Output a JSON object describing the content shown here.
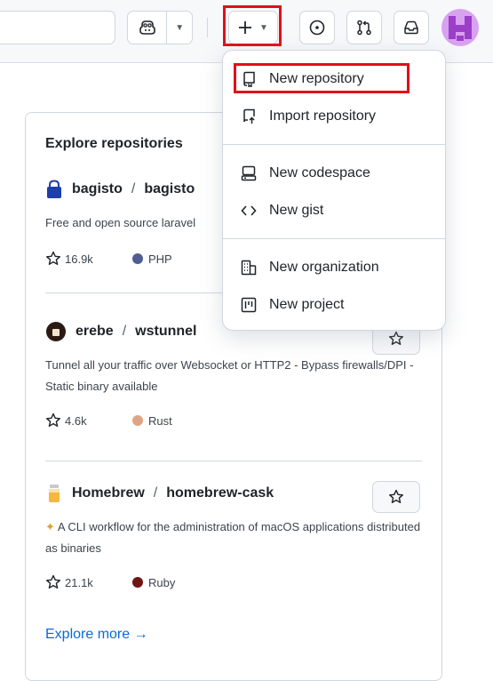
{
  "menu": {
    "items": [
      {
        "label": "New repository",
        "icon": "repo-icon"
      },
      {
        "label": "Import repository",
        "icon": "repo-push-icon"
      },
      {
        "label": "New codespace",
        "icon": "codespaces-icon"
      },
      {
        "label": "New gist",
        "icon": "code-icon"
      },
      {
        "label": "New organization",
        "icon": "organization-icon"
      },
      {
        "label": "New project",
        "icon": "project-icon"
      }
    ]
  },
  "explore": {
    "title": "Explore repositories",
    "repos": [
      {
        "owner": "bagisto",
        "name": "bagisto",
        "desc": "Free and open source laravel",
        "stars": "16.9k",
        "lang": "PHP",
        "lang_color": "#4F5D95",
        "avatar_color": "#1c3faa"
      },
      {
        "owner": "erebe",
        "name": "wstunnel",
        "desc": "Tunnel all your traffic over Websocket or HTTP2 - Bypass firewalls/DPI - Static binary available",
        "stars": "4.6k",
        "lang": "Rust",
        "lang_color": "#dea584",
        "avatar_color": "#2b1a12"
      },
      {
        "owner": "Homebrew",
        "name": "homebrew-cask",
        "desc": "A CLI workflow for the administration of macOS applications distributed as binaries",
        "stars": "21.1k",
        "lang": "Ruby",
        "lang_color": "#701516",
        "avatar_color": "#f5b642"
      }
    ],
    "more": "Explore more →"
  },
  "colors": {
    "highlight": "#e0101a",
    "link": "#0969da",
    "avatar_bg": "#d9a2f0"
  }
}
